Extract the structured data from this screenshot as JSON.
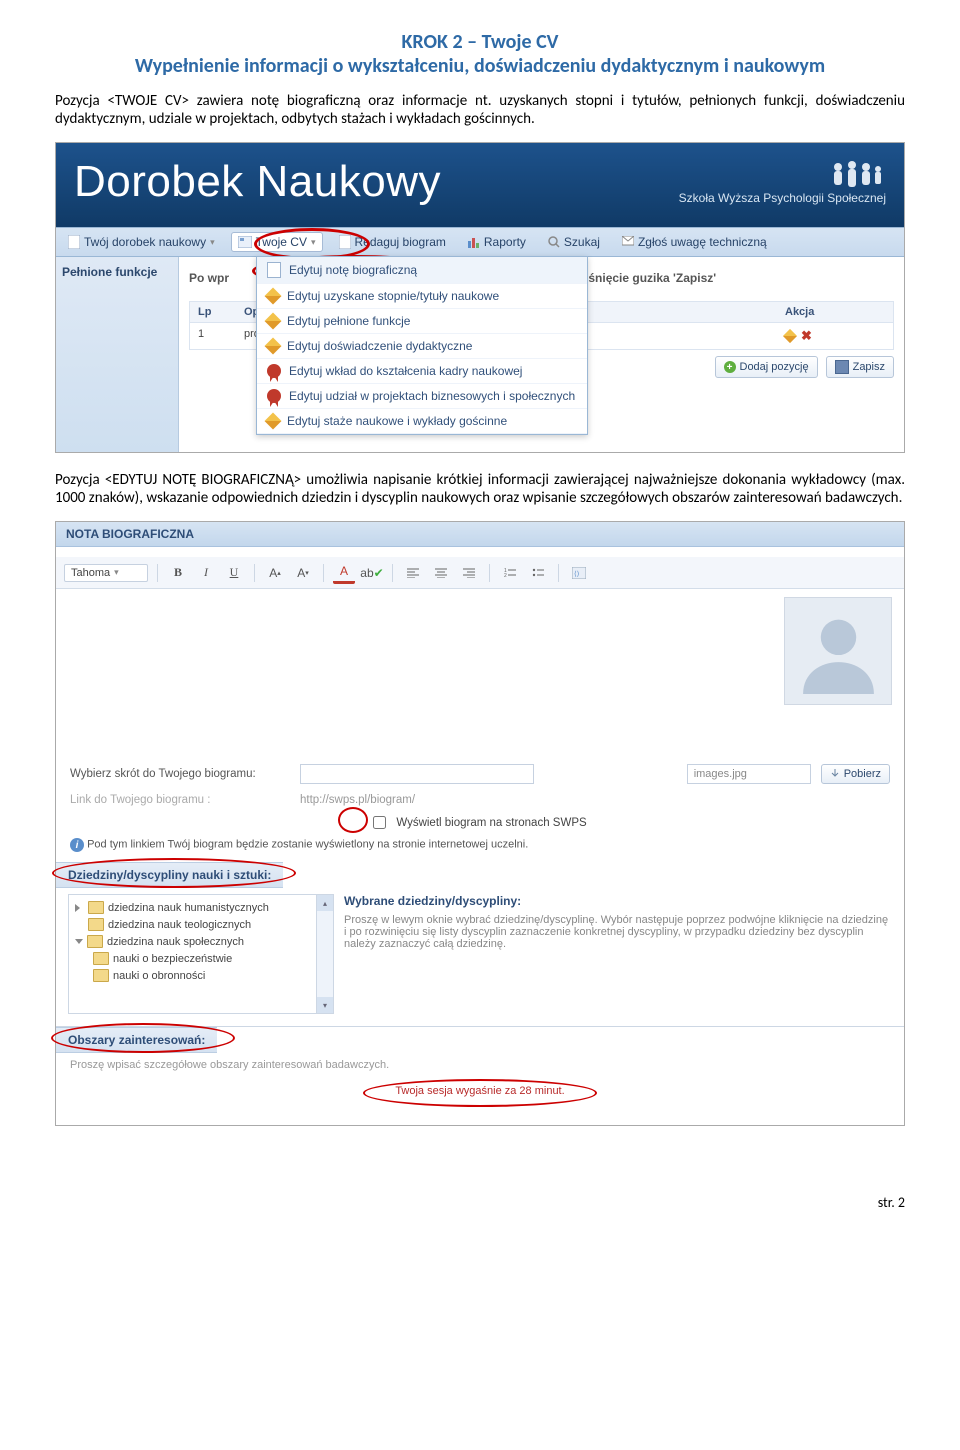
{
  "heading": {
    "line1": "KROK 2 – Twoje CV",
    "line2": "Wypełnienie informacji o wykształceniu, doświadczeniu dydaktycznym i naukowym"
  },
  "para1": "Pozycja <TWOJE CV> zawiera notę biograficzną oraz informacje nt. uzyskanych stopni i tytułów, pełnionych funkcji, doświadczeniu dydaktycznym, udziale w projektach, odbytych stażach i wykładach gościnnych.",
  "app": {
    "title": "Dorobek Naukowy",
    "school": "Szkoła Wyższa Psychologii Społecznej",
    "toolbar": {
      "item1": "Twój dorobek naukowy",
      "item2": "Twoje CV",
      "item3": "Redaguj biogram",
      "item4": "Raporty",
      "item5": "Szukaj",
      "item6": "Zgłoś uwagę techniczną"
    },
    "dropdown": {
      "d1": "Edytuj notę biograficzną",
      "d2": "Edytuj uzyskane stopnie/tytuły naukowe",
      "d3": "Edytuj pełnione funkcje",
      "d4": "Edytuj doświadczenie dydaktyczne",
      "d5": "Edytuj wkład do kształcenia kadry naukowej",
      "d6": "Edytuj udział w projektach biznesowych i społecznych",
      "d7": "Edytuj staże naukowe i wykłady gościnne"
    },
    "panel": {
      "side": "Pełnione funkcje",
      "instr_l": "Po wpr",
      "instr_r": "wciśnięcie guzika 'Zapisz'",
      "hdr_lp": "Lp",
      "hdr_opis": "Opis",
      "hdr_akcja": "Akcja",
      "row_lp": "1",
      "row_opis": "prodziekan ds. nau",
      "btn_add": "Dodaj pozycję",
      "btn_save": "Zapisz"
    }
  },
  "para2": "Pozycja <EDYTUJ NOTĘ BIOGRAFICZNĄ> umożliwia napisanie krótkiej informacji zawierającej najważniejsze dokonania wykładowcy (max. 1000 znaków), wskazanie odpowiednich dziedzin i dyscyplin naukowych oraz wpisanie szczegółowych obszarów zainteresowań badawczych.",
  "bio": {
    "title": "NOTA BIOGRAFICZNA",
    "font": "Tahoma",
    "lbl_shortcut": "Wybierz skrót do Twojego biogramu:",
    "lbl_link": "Link do Twojego biogramu :",
    "link_value": "http://swps.pl/biogram/",
    "chk_publish": "Wyświetl biogram na stronach SWPS",
    "file_value": "images.jpg",
    "btn_download": "Pobierz",
    "info_text": "Pod tym linkiem Twój biogram będzie zostanie wyświetlony na stronie internetowej uczelni.",
    "dz_header": "Dziedziny/dyscypliny nauki i sztuki:",
    "dz_wyb": "Wybrane dziedziny/dyscypliny:",
    "tree": {
      "n1": "dziedzina nauk humanistycznych",
      "n2": "dziedzina nauk teologicznych",
      "n3": "dziedzina nauk społecznych",
      "n4": "nauki o bezpieczeństwie",
      "n5": "nauki o obronności"
    },
    "help_txt": "Proszę w lewym oknie wybrać dziedzinę/dyscyplinę. Wybór następuje poprzez podwójne kliknięcie na dziedzinę i po rozwinięciu się listy dyscyplin zaznaczenie konkretnej dyscypliny, w przypadku dziedziny bez dyscyplin należy zaznaczyć całą dziedzinę.",
    "int_header": "Obszary zainteresowań:",
    "int_placeholder": "Proszę wpisać szczegółowe obszary zainteresowań badawczych.",
    "session": "Twoja sesja wygaśnie za 28 minut."
  },
  "footer": "str. 2"
}
